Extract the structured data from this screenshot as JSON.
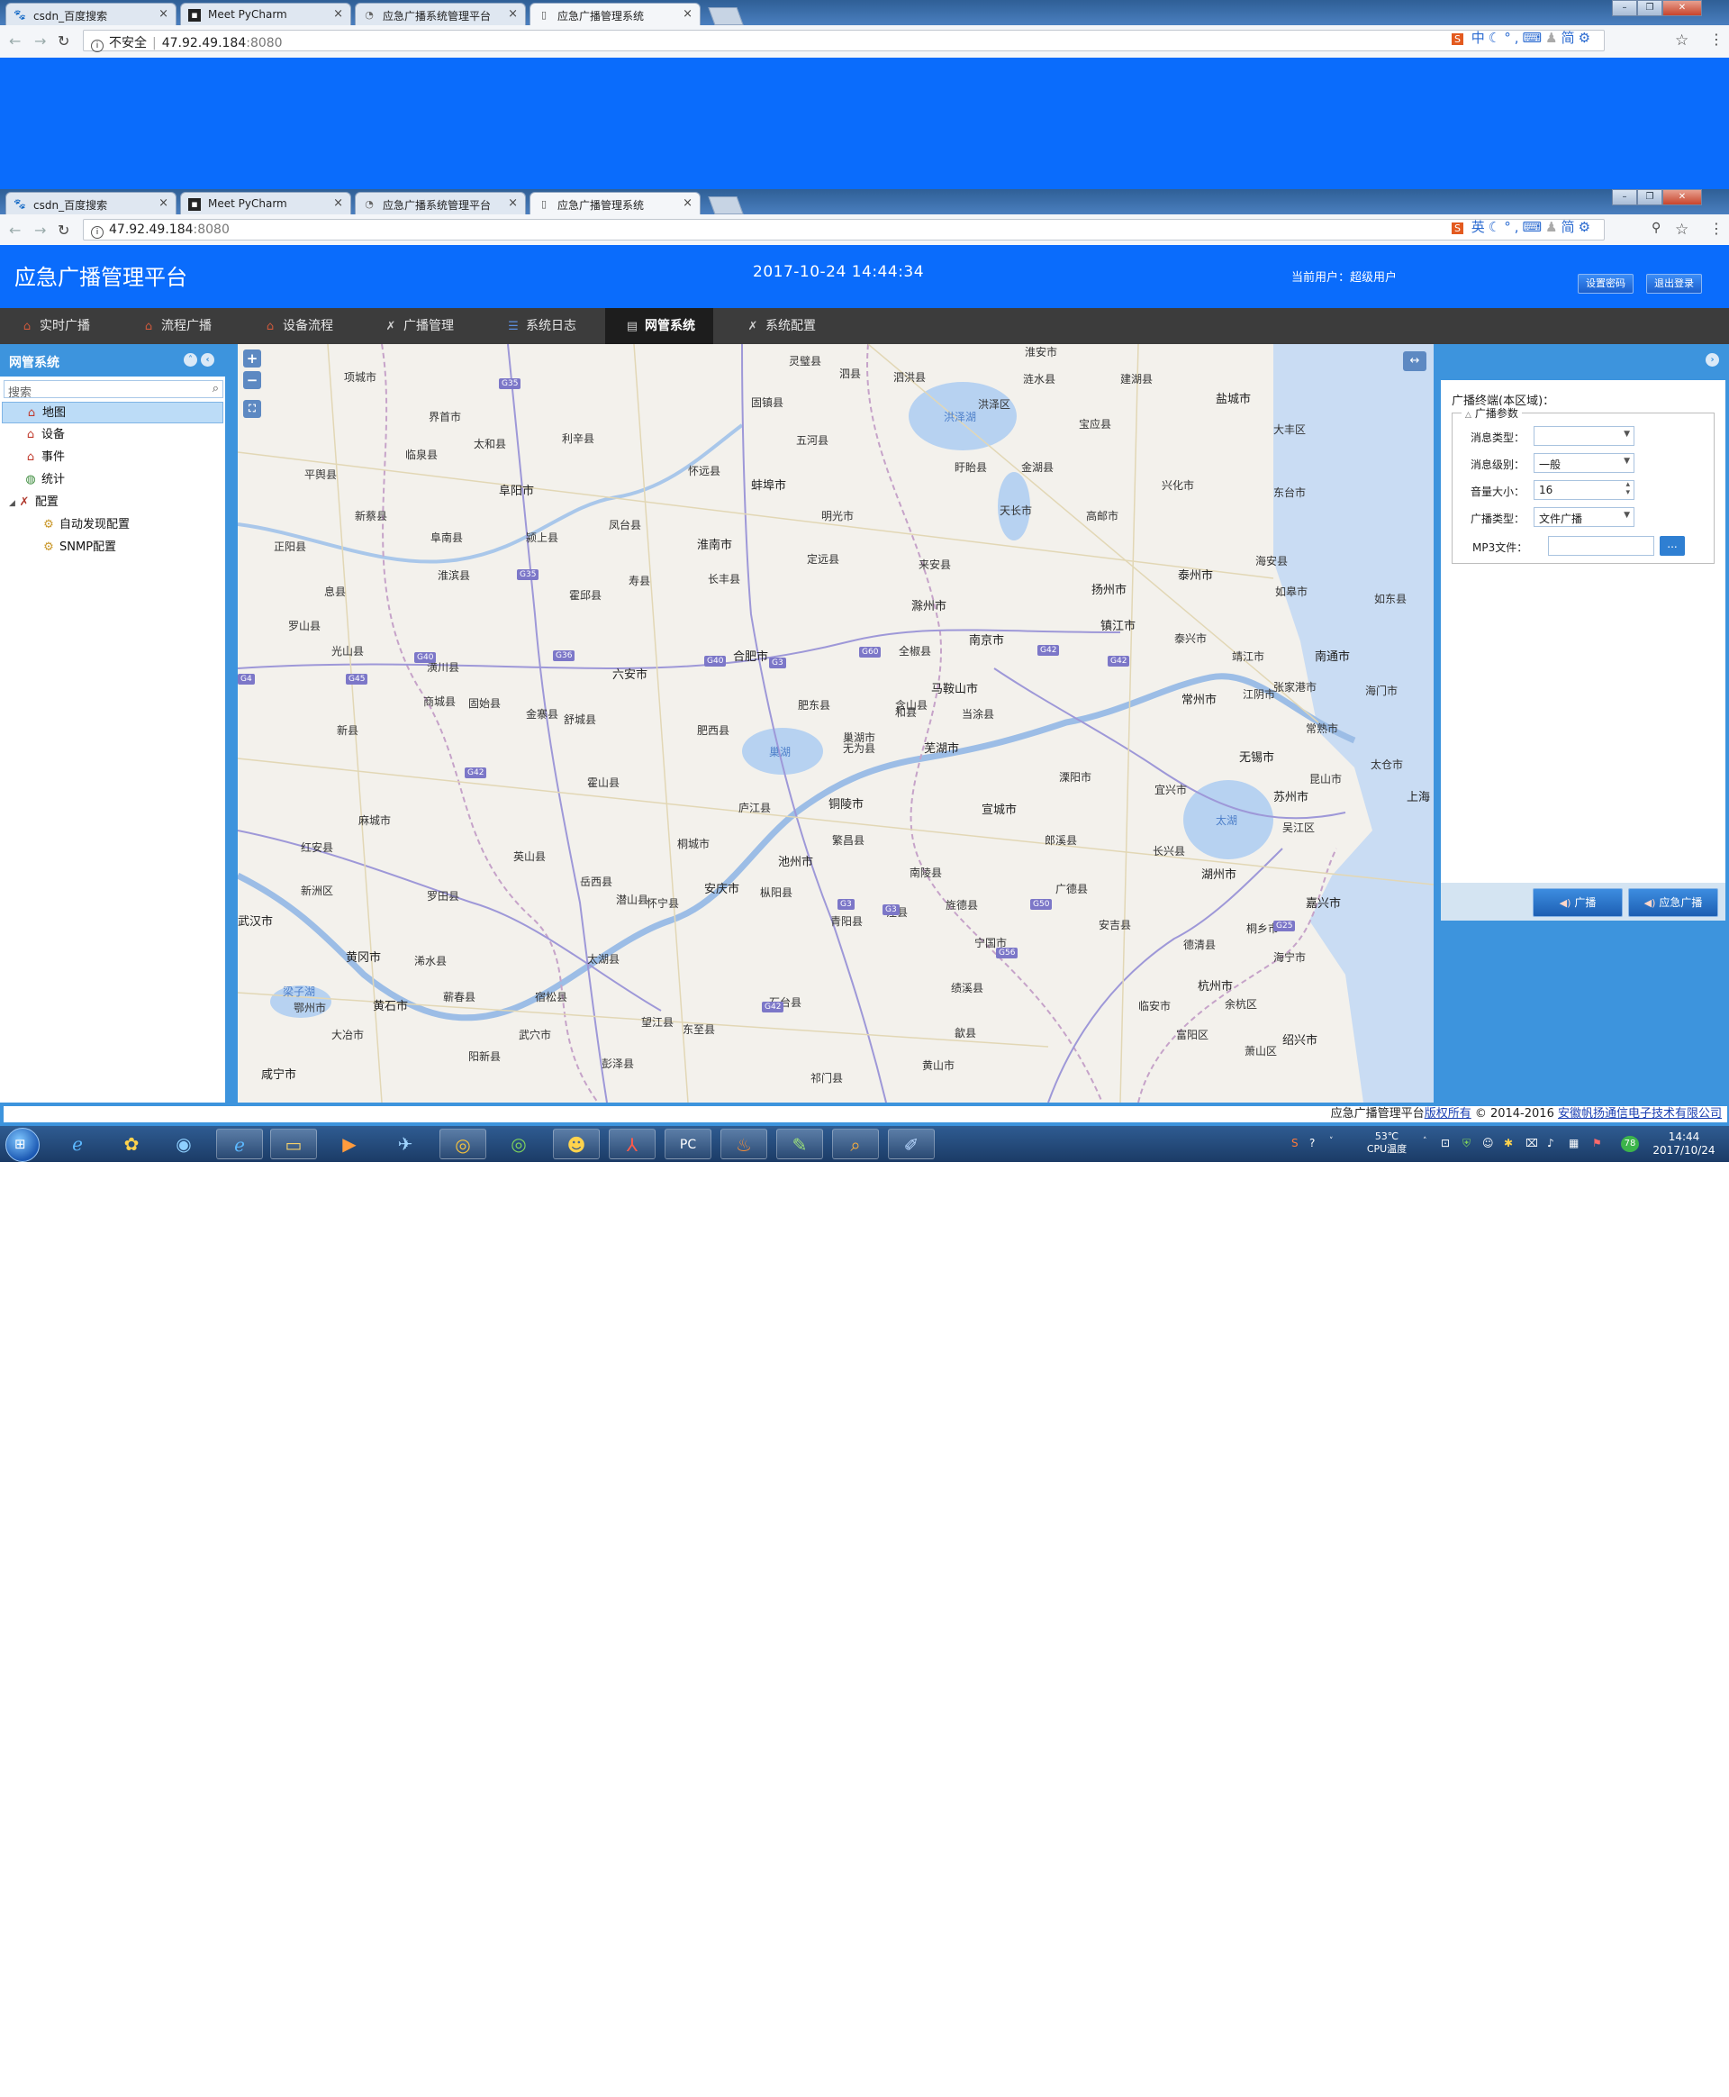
{
  "browser": {
    "tabs": [
      {
        "title": "csdn_百度搜索",
        "icon": "paw-icon"
      },
      {
        "title": "Meet PyCharm",
        "icon": "pycharm-icon"
      },
      {
        "title": "应急广播系统管理平台",
        "icon": "loading-icon"
      },
      {
        "title": "应急广播管理系统",
        "icon": "page-icon"
      }
    ],
    "url_security": "不安全",
    "url_host": "47.92.49.184",
    "url_port": ":8080",
    "ime_top": "中",
    "ime_bottom": "英",
    "ime_simplified": "简"
  },
  "header": {
    "title": "应急广播管理平台",
    "datetime": "2017-10-24  14:44:34",
    "current_user": "当前用户：超级用户",
    "btn_set_password": "设置密码",
    "btn_logout": "退出登录"
  },
  "menu": {
    "items": [
      {
        "label": "实时广播"
      },
      {
        "label": "流程广播"
      },
      {
        "label": "设备流程"
      },
      {
        "label": "广播管理"
      },
      {
        "label": "系统日志"
      },
      {
        "label": "网管系统"
      },
      {
        "label": "系统配置"
      }
    ],
    "active_index": 5
  },
  "left_panel": {
    "title": "网管系统",
    "search_placeholder": "搜索",
    "tree": [
      {
        "label": "地图",
        "icon": "house-icon",
        "selected": true
      },
      {
        "label": "设备",
        "icon": "house-icon"
      },
      {
        "label": "事件",
        "icon": "house-icon"
      },
      {
        "label": "统计",
        "icon": "globe-icon"
      },
      {
        "label": "配置",
        "icon": "tools-icon",
        "expanded": true
      },
      {
        "label": "自动发现配置",
        "icon": "gear-icon"
      },
      {
        "label": "SNMP配置",
        "icon": "gear-icon"
      }
    ]
  },
  "map": {
    "cities": [
      {
        "name": "阜阳市"
      },
      {
        "name": "蚌埠市"
      },
      {
        "name": "淮南市"
      },
      {
        "name": "滁州市"
      },
      {
        "name": "合肥市"
      },
      {
        "name": "六安市"
      },
      {
        "name": "南京市"
      },
      {
        "name": "马鞍山市"
      },
      {
        "name": "芜湖市"
      },
      {
        "name": "铜陵市"
      },
      {
        "name": "池州市"
      },
      {
        "name": "安庆市"
      },
      {
        "name": "宣城市"
      },
      {
        "name": "扬州市"
      },
      {
        "name": "镇江市"
      },
      {
        "name": "泰州市"
      },
      {
        "name": "常州市"
      },
      {
        "name": "无锡市"
      },
      {
        "name": "苏州市"
      },
      {
        "name": "上海"
      },
      {
        "name": "南通市"
      },
      {
        "name": "湖州市"
      },
      {
        "name": "嘉兴市"
      },
      {
        "name": "杭州市"
      },
      {
        "name": "绍兴市"
      },
      {
        "name": "盐城市"
      },
      {
        "name": "黄冈市"
      },
      {
        "name": "黄石市"
      },
      {
        "name": "武汉市"
      },
      {
        "name": "咸宁市"
      }
    ],
    "counties": [
      {
        "name": "项城市"
      },
      {
        "name": "界首市"
      },
      {
        "name": "太和县"
      },
      {
        "name": "临泉县"
      },
      {
        "name": "利辛县"
      },
      {
        "name": "怀远县"
      },
      {
        "name": "凤台县"
      },
      {
        "name": "定远县"
      },
      {
        "name": "长丰县"
      },
      {
        "name": "全椒县"
      },
      {
        "name": "来安县"
      },
      {
        "name": "舒城县"
      },
      {
        "name": "庐江县"
      },
      {
        "name": "无为县"
      },
      {
        "name": "和县"
      },
      {
        "name": "当涂县"
      },
      {
        "name": "霍山县"
      },
      {
        "name": "金寨县"
      },
      {
        "name": "固始县"
      },
      {
        "name": "潢川县"
      },
      {
        "name": "桐城市"
      },
      {
        "name": "枞阳县"
      },
      {
        "name": "潜山县"
      },
      {
        "name": "太湖县"
      },
      {
        "name": "宿松县"
      },
      {
        "name": "东至县"
      },
      {
        "name": "石台县"
      },
      {
        "name": "青阳县"
      },
      {
        "name": "泾县"
      },
      {
        "name": "南陵县"
      },
      {
        "name": "繁昌县"
      },
      {
        "name": "溧阳市"
      },
      {
        "name": "宜兴市"
      },
      {
        "name": "长兴县"
      },
      {
        "name": "安吉县"
      },
      {
        "name": "德清县"
      },
      {
        "name": "海宁市"
      },
      {
        "name": "桐乡市"
      },
      {
        "name": "临安市"
      },
      {
        "name": "富阳区"
      },
      {
        "name": "余杭区"
      },
      {
        "name": "萧山区"
      },
      {
        "name": "泰兴市"
      },
      {
        "name": "靖江市"
      },
      {
        "name": "江阴市"
      },
      {
        "name": "张家港市"
      },
      {
        "name": "常熟市"
      },
      {
        "name": "昆山市"
      },
      {
        "name": "太仓市"
      },
      {
        "name": "吴江区"
      },
      {
        "name": "海门市"
      },
      {
        "name": "如东县"
      },
      {
        "name": "如皋市"
      },
      {
        "name": "海安县"
      },
      {
        "name": "东台市"
      },
      {
        "name": "兴化市"
      },
      {
        "name": "高邮市"
      },
      {
        "name": "宝应县"
      },
      {
        "name": "金湖县"
      },
      {
        "name": "盱眙县"
      },
      {
        "name": "天长市"
      },
      {
        "name": "明光市"
      },
      {
        "name": "五河县"
      },
      {
        "name": "固镇县"
      },
      {
        "name": "灵璧县"
      },
      {
        "name": "泗县"
      },
      {
        "name": "泗洪县"
      },
      {
        "name": "洪泽区"
      },
      {
        "name": "涟水县"
      },
      {
        "name": "建湖县"
      },
      {
        "name": "大丰区"
      },
      {
        "name": "淮安市"
      },
      {
        "name": "麻城市"
      },
      {
        "name": "罗田县"
      },
      {
        "name": "英山县"
      },
      {
        "name": "浠水县"
      },
      {
        "name": "蕲春县"
      },
      {
        "name": "武穴市"
      },
      {
        "name": "阳新县"
      },
      {
        "name": "大冶市"
      },
      {
        "name": "鄂州市"
      },
      {
        "name": "新洲区"
      },
      {
        "name": "红安县"
      },
      {
        "name": "新县"
      },
      {
        "name": "光山县"
      },
      {
        "name": "商城县"
      },
      {
        "name": "罗山县"
      },
      {
        "name": "息县"
      },
      {
        "name": "淮滨县"
      },
      {
        "name": "正阳县"
      },
      {
        "name": "平舆县"
      },
      {
        "name": "新蔡县"
      },
      {
        "name": "阜南县"
      },
      {
        "name": "颍上县"
      },
      {
        "name": "霍邱县"
      },
      {
        "name": "寿县"
      },
      {
        "name": "肥西县"
      },
      {
        "name": "肥东县"
      },
      {
        "name": "巢湖市"
      },
      {
        "name": "含山县"
      },
      {
        "name": "郎溪县"
      },
      {
        "name": "广德县"
      },
      {
        "name": "宁国市"
      },
      {
        "name": "旌德县"
      },
      {
        "name": "绩溪县"
      },
      {
        "name": "歙县"
      },
      {
        "name": "黄山市"
      },
      {
        "name": "祁门县"
      },
      {
        "name": "彭泽县"
      },
      {
        "name": "望江县"
      },
      {
        "name": "怀宁县"
      },
      {
        "name": "岳西县"
      }
    ],
    "roads": [
      "G35",
      "G36",
      "G40",
      "G3",
      "G60",
      "G42",
      "G50",
      "G56",
      "G4",
      "G45",
      "G25"
    ],
    "lakes": [
      "洪泽湖",
      "巢湖",
      "太湖",
      "梁子湖"
    ]
  },
  "right_panel": {
    "caption": "广播终端(本区域)：",
    "group_title": "广播参数",
    "fields": [
      {
        "label": "消息类型：",
        "value": ""
      },
      {
        "label": "消息级别：",
        "value": "一般"
      },
      {
        "label": "音量大小：",
        "value": "16"
      },
      {
        "label": "广播类型：",
        "value": "文件广播"
      },
      {
        "label": "MP3文件：",
        "value": ""
      }
    ],
    "browse_label": "...",
    "btn_broadcast": "广播",
    "btn_emergency": "应急广播"
  },
  "footer": {
    "prefix": "应急广播管理平台",
    "rights": "版权所有",
    "years": "© 2014-2016",
    "company": "安徽帆扬通信电子技术有限公司"
  },
  "taskbar": {
    "cpu_temp": "53℃",
    "cpu_label": "CPU温度",
    "time": "14:44",
    "date": "2017/10/24",
    "badge": "78"
  },
  "colors": {
    "brand_blue": "#0a6cfc",
    "panel_blue": "#3d94dd",
    "menu_dark": "#3c3c3c"
  }
}
